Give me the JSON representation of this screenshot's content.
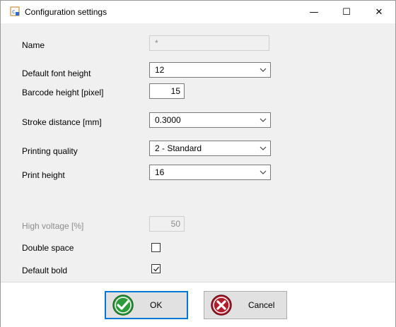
{
  "window": {
    "title": "Configuration settings",
    "minimize_glyph": "—",
    "maximize_glyph": "☐",
    "close_glyph": "✕"
  },
  "fields": {
    "name": {
      "label": "Name",
      "value": "*"
    },
    "default_font_height": {
      "label": "Default font height",
      "value": "12"
    },
    "barcode_height": {
      "label": "Barcode height [pixel]",
      "value": "15"
    },
    "stroke_distance": {
      "label": "Stroke distance [mm]",
      "value": "0.3000"
    },
    "printing_quality": {
      "label": "Printing quality",
      "value": "2 - Standard"
    },
    "print_height": {
      "label": "Print height",
      "value": "16"
    },
    "high_voltage": {
      "label": "High voltage [%]",
      "value": "50"
    },
    "double_space": {
      "label": "Double space",
      "checked": false
    },
    "default_bold": {
      "label": "Default bold",
      "checked": true
    }
  },
  "buttons": {
    "ok": {
      "label": "OK",
      "icon": "check-icon"
    },
    "cancel": {
      "label": "Cancel",
      "icon": "cross-icon"
    }
  },
  "colors": {
    "ok_icon": "#2e9b3a",
    "cancel_icon": "#b01e2c",
    "default_button_border": "#0078d7",
    "dialog_background": "#f0f0f0"
  }
}
